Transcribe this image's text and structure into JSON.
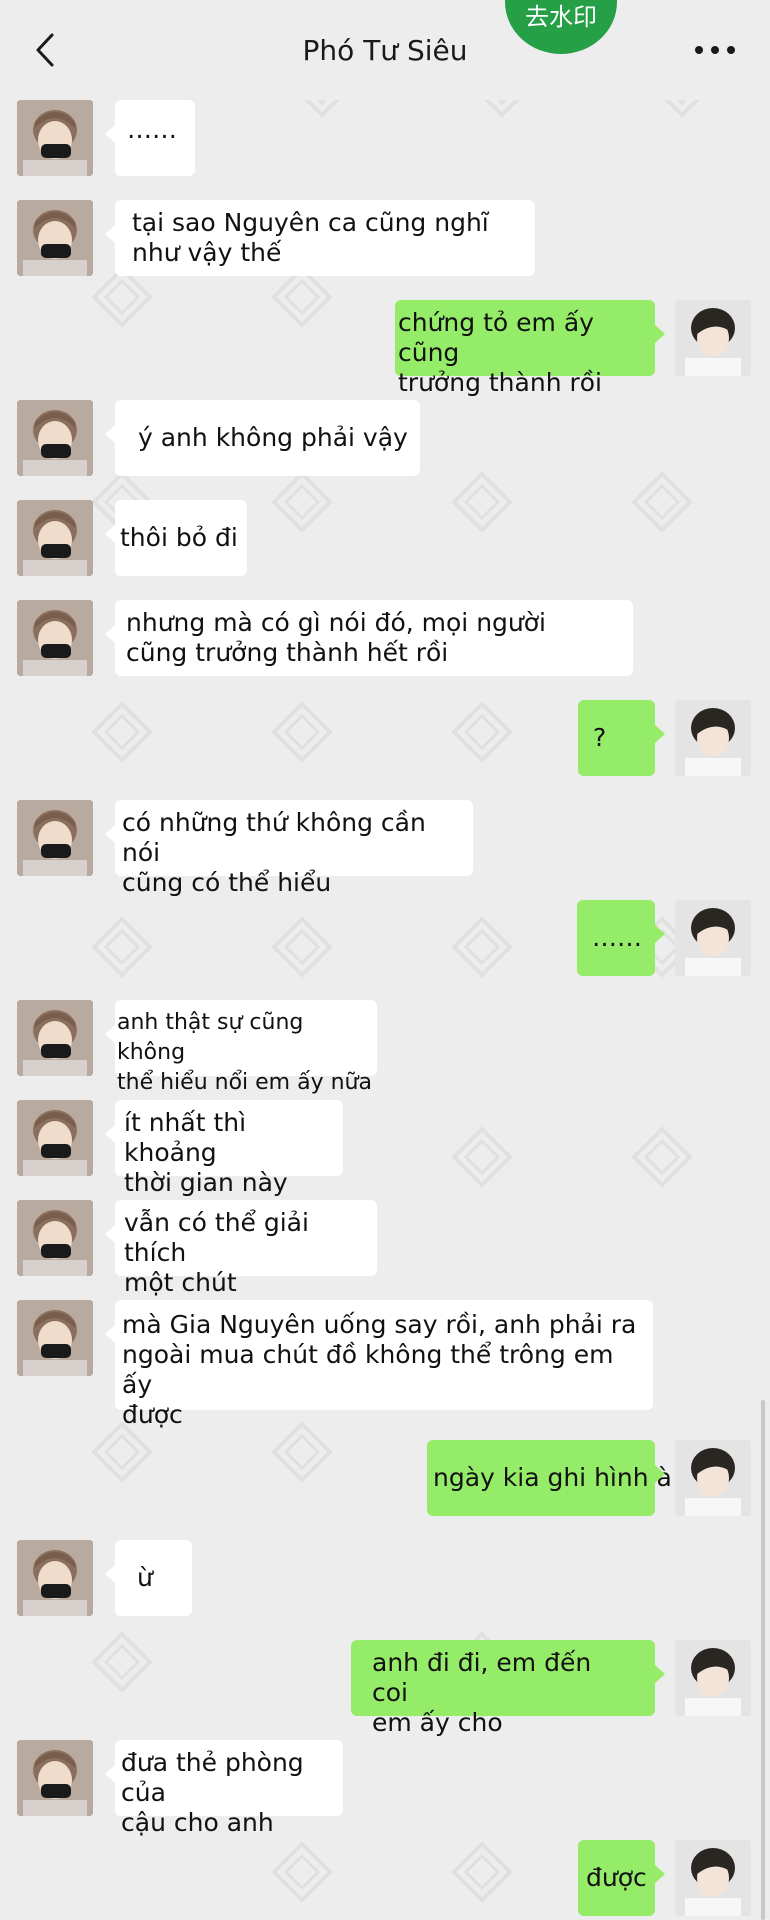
{
  "header": {
    "title": "Phó Tư Siêu",
    "badge": "去水印"
  },
  "messages": [
    {
      "side": "left",
      "text": "……"
    },
    {
      "side": "left",
      "text": "tại sao Nguyên ca cũng nghĩ\nnhư vậy thế"
    },
    {
      "side": "right",
      "text": "chứng tỏ em ấy cũng\ntrưởng thành rồi"
    },
    {
      "side": "left",
      "text": "ý anh không phải vậy"
    },
    {
      "side": "left",
      "text": "thôi bỏ đi"
    },
    {
      "side": "left",
      "text": "nhưng mà có gì nói đó, mọi người\ncũng trưởng thành hết rồi"
    },
    {
      "side": "right",
      "text": "?"
    },
    {
      "side": "left",
      "text": "có những thứ không cần nói\ncũng có thể hiểu"
    },
    {
      "side": "right",
      "text": "……"
    },
    {
      "side": "left",
      "text": "anh thật sự cũng không\nthể hiểu nổi em ấy nữa"
    },
    {
      "side": "left",
      "text": "ít nhất thì khoảng\nthời gian này"
    },
    {
      "side": "left",
      "text": "vẫn có thể giải thích\nmột chút"
    },
    {
      "side": "left",
      "text": "mà Gia Nguyên uống say rồi, anh phải ra\nngoài mua chút đồ không thể trông em ấy\nđược"
    },
    {
      "side": "right",
      "text": "ngày kia ghi hình à"
    },
    {
      "side": "left",
      "text": "ừ"
    },
    {
      "side": "right",
      "text": "anh đi đi, em đến coi\nem ấy cho"
    },
    {
      "side": "left",
      "text": "đưa thẻ phòng của\ncậu cho anh"
    },
    {
      "side": "right",
      "text": "được"
    }
  ],
  "colors": {
    "background": "#ededed",
    "bubble_left": "#ffffff",
    "bubble_right": "#95ec69",
    "badge": "#25a047"
  }
}
